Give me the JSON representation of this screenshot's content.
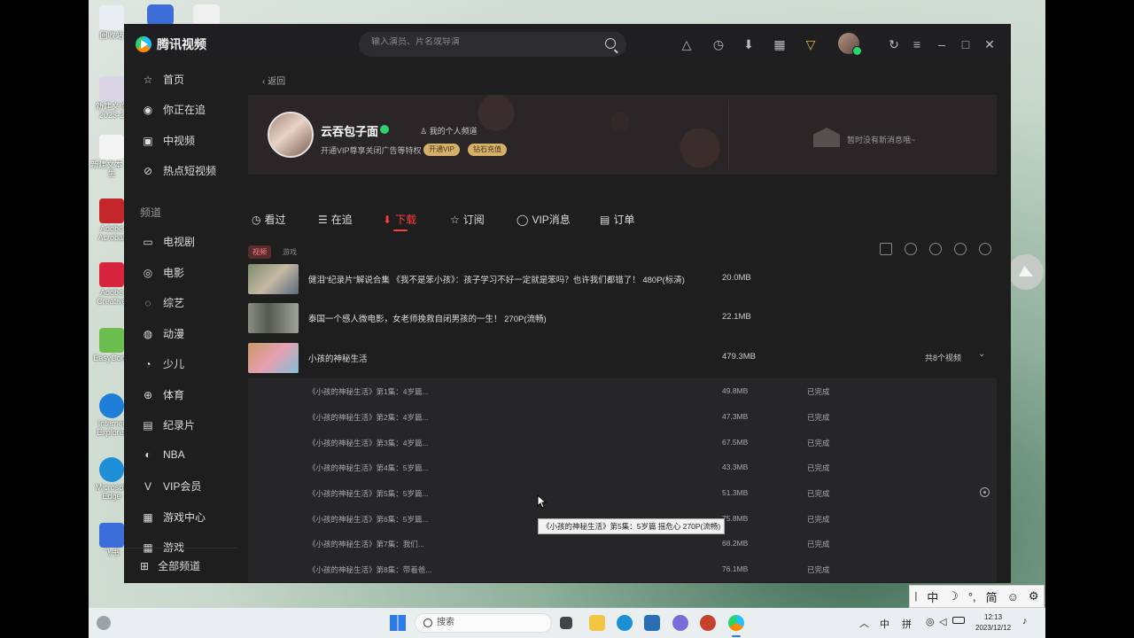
{
  "desktop": {
    "icons": [
      {
        "label": "回收站",
        "color": "#e8eef4"
      },
      {
        "label": "新建文件 2023-2",
        "color": "#d9d4e6"
      },
      {
        "label": "新建文本 学生",
        "color": "#f4f4f4"
      },
      {
        "label": "Adobe Acrobat",
        "color": "#c3262a"
      },
      {
        "label": "Adobe Creative",
        "color": "#d8243c"
      },
      {
        "label": "EasyConn",
        "color": "#6bbf4e"
      },
      {
        "label": "Internet Explorer",
        "color": "#1f7fd8"
      },
      {
        "label": "Microsoft Edge",
        "color": "#1e8fd6"
      },
      {
        "label": "飞书",
        "color": "#3b6ed8"
      }
    ]
  },
  "app": {
    "logo_text": "腾讯视频",
    "search_placeholder": "输入演员、片名或导演",
    "sidebar": {
      "items": [
        {
          "icon": "star-icon",
          "glyph": "☆",
          "label": "首页"
        },
        {
          "icon": "eye-icon",
          "glyph": "◉",
          "label": "你正在追"
        },
        {
          "icon": "play-box-icon",
          "glyph": "▣",
          "label": "中视频"
        },
        {
          "icon": "compass-icon",
          "glyph": "⊘",
          "label": "热点短视频"
        }
      ],
      "channel_title": "频道",
      "channels": [
        {
          "icon": "tv-icon",
          "glyph": "▭",
          "label": "电视剧"
        },
        {
          "icon": "film-icon",
          "glyph": "◎",
          "label": "电影"
        },
        {
          "icon": "mic-icon",
          "glyph": "◌",
          "label": "综艺"
        },
        {
          "icon": "anime-icon",
          "glyph": "◍",
          "label": "动漫"
        },
        {
          "icon": "kids-icon",
          "glyph": "◔",
          "label": "少儿"
        },
        {
          "icon": "ball-icon",
          "glyph": "⊕",
          "label": "体育"
        },
        {
          "icon": "doc-icon",
          "glyph": "▤",
          "label": "纪录片"
        },
        {
          "icon": "nba-icon",
          "glyph": "◐",
          "label": "NBA"
        },
        {
          "icon": "vip-icon",
          "glyph": "V",
          "label": "VIP会员"
        },
        {
          "icon": "gamepad-icon",
          "glyph": "▦",
          "label": "游戏中心"
        },
        {
          "icon": "game-icon",
          "glyph": "▦",
          "label": "游戏"
        }
      ],
      "all_channels": "全部频道"
    },
    "back_label": "返回",
    "profile": {
      "name": "云吞包子面",
      "my_channel": "我的个人频道",
      "vip_tip": "开通VIP尊享关闭广告等特权",
      "vip_button": "开通VIP",
      "diamond_button": "钻石充值",
      "no_message": "暂时没有新消息哦~"
    },
    "tabs": [
      {
        "icon": "history-icon",
        "glyph": "◷",
        "label": "看过"
      },
      {
        "icon": "list-icon",
        "glyph": "☰",
        "label": "在追"
      },
      {
        "icon": "download-icon",
        "glyph": "⬇",
        "label": "下载"
      },
      {
        "icon": "subscribe-icon",
        "glyph": "☆",
        "label": "订阅"
      },
      {
        "icon": "message-icon",
        "glyph": "◯",
        "label": "VIP消息"
      },
      {
        "icon": "order-icon",
        "glyph": "▤",
        "label": "订单"
      }
    ],
    "active_tab": "下载",
    "sub_tabs": [
      "视频",
      "游戏"
    ],
    "downloads": [
      {
        "title": "健泪“纪录片”解说合集 《我不是笨小孩》：孩子学习不好一定就是笨吗？也许我们都错了！ 480P(标清)",
        "size": "20.0MB",
        "thumb": "#7b8a6a"
      },
      {
        "title": "泰国一个感人微电影，女老师挽救自闭男孩的一生！ 270P(流畅)",
        "size": "22.1MB",
        "thumb": "#8a8f86"
      },
      {
        "title": "小孩的神秘生活",
        "size": "479.3MB",
        "count": "共8个视频",
        "thumb": "#c89a6a"
      }
    ],
    "episodes": [
      {
        "title": "《小孩的神秘生活》第1集：4岁篇...",
        "size": "49.8MB",
        "status": "已完成"
      },
      {
        "title": "《小孩的神秘生活》第2集：4岁篇...",
        "size": "47.3MB",
        "status": "已完成"
      },
      {
        "title": "《小孩的神秘生活》第3集：4岁篇...",
        "size": "67.5MB",
        "status": "已完成"
      },
      {
        "title": "《小孩的神秘生活》第4集：5岁篇...",
        "size": "43.3MB",
        "status": "已完成"
      },
      {
        "title": "《小孩的神秘生活》第5集：5岁篇...",
        "size": "51.3MB",
        "status": "已完成"
      },
      {
        "title": "《小孩的神秘生活》第6集：5岁篇...",
        "size": "75.8MB",
        "status": "已完成"
      },
      {
        "title": "《小孩的神秘生活》第7集：我们...",
        "size": "68.2MB",
        "status": "已完成"
      },
      {
        "title": "《小孩的神秘生活》第8集：带着爸...",
        "size": "76.1MB",
        "status": "已完成"
      }
    ],
    "tooltip": "《小孩的神秘生活》第5集：5岁篇 摇危心 270P(流畅)"
  },
  "ime": [
    "中",
    "简"
  ],
  "taskbar": {
    "search_placeholder": "搜索",
    "tray_lang": "中",
    "tray_pinyin": "拼",
    "time": "12:13",
    "date": "2023/12/12"
  }
}
